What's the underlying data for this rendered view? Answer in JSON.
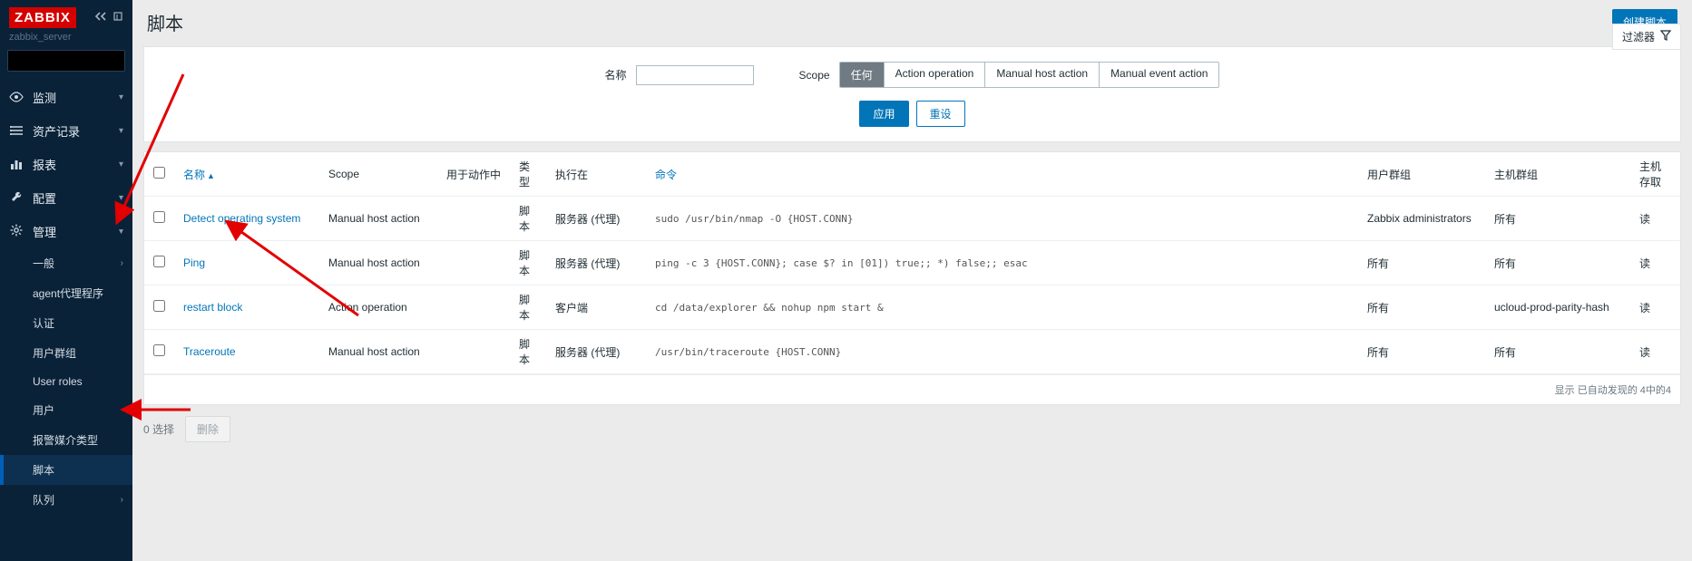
{
  "brand": {
    "logo": "ZABBIX",
    "server": "zabbix_server"
  },
  "sidebar": {
    "items": [
      {
        "icon": "eye",
        "label": "监测"
      },
      {
        "icon": "list",
        "label": "资产记录"
      },
      {
        "icon": "bar",
        "label": "报表"
      },
      {
        "icon": "wrench",
        "label": "配置"
      },
      {
        "icon": "gear",
        "label": "管理"
      }
    ],
    "admin_sub": [
      {
        "label": "一般",
        "caret": true
      },
      {
        "label": "agent代理程序"
      },
      {
        "label": "认证"
      },
      {
        "label": "用户群组"
      },
      {
        "label": "User roles"
      },
      {
        "label": "用户"
      },
      {
        "label": "报警媒介类型"
      },
      {
        "label": "脚本",
        "active": true
      },
      {
        "label": "队列",
        "caret": true
      }
    ]
  },
  "page": {
    "title": "脚本",
    "create_btn": "创建脚本",
    "filter_toggle": "过滤器"
  },
  "filter": {
    "name_label": "名称",
    "scope_label": "Scope",
    "scope_options": [
      "任何",
      "Action operation",
      "Manual host action",
      "Manual event action"
    ],
    "apply": "应用",
    "reset": "重设"
  },
  "table": {
    "headers": {
      "name": "名称",
      "scope": "Scope",
      "used": "用于动作中",
      "type": "类型",
      "exec": "执行在",
      "cmd": "命令",
      "ug": "用户群组",
      "hg": "主机群组",
      "acc": "主机存取"
    },
    "rows": [
      {
        "name": "Detect operating system",
        "scope": "Manual host action",
        "used": "",
        "type": "脚本",
        "exec": "服务器 (代理)",
        "cmd": "sudo /usr/bin/nmap -O {HOST.CONN}",
        "ug": "Zabbix administrators",
        "hg": "所有",
        "acc": "读"
      },
      {
        "name": "Ping",
        "scope": "Manual host action",
        "used": "",
        "type": "脚本",
        "exec": "服务器 (代理)",
        "cmd": "ping -c 3 {HOST.CONN}; case $? in [01]) true;; *) false;; esac",
        "ug": "所有",
        "hg": "所有",
        "acc": "读"
      },
      {
        "name": "restart block",
        "scope": "Action operation",
        "used": "",
        "type": "脚本",
        "exec": "客户端",
        "cmd": "cd /data/explorer && nohup npm start &",
        "ug": "所有",
        "hg": "ucloud-prod-parity-hash",
        "acc": "读"
      },
      {
        "name": "Traceroute",
        "scope": "Manual host action",
        "used": "",
        "type": "脚本",
        "exec": "服务器 (代理)",
        "cmd": "/usr/bin/traceroute {HOST.CONN}",
        "ug": "所有",
        "hg": "所有",
        "acc": "读"
      }
    ],
    "footer": "显示 已自动发现的 4中的4"
  },
  "bulk": {
    "selected": "0 选择",
    "delete": "删除"
  }
}
